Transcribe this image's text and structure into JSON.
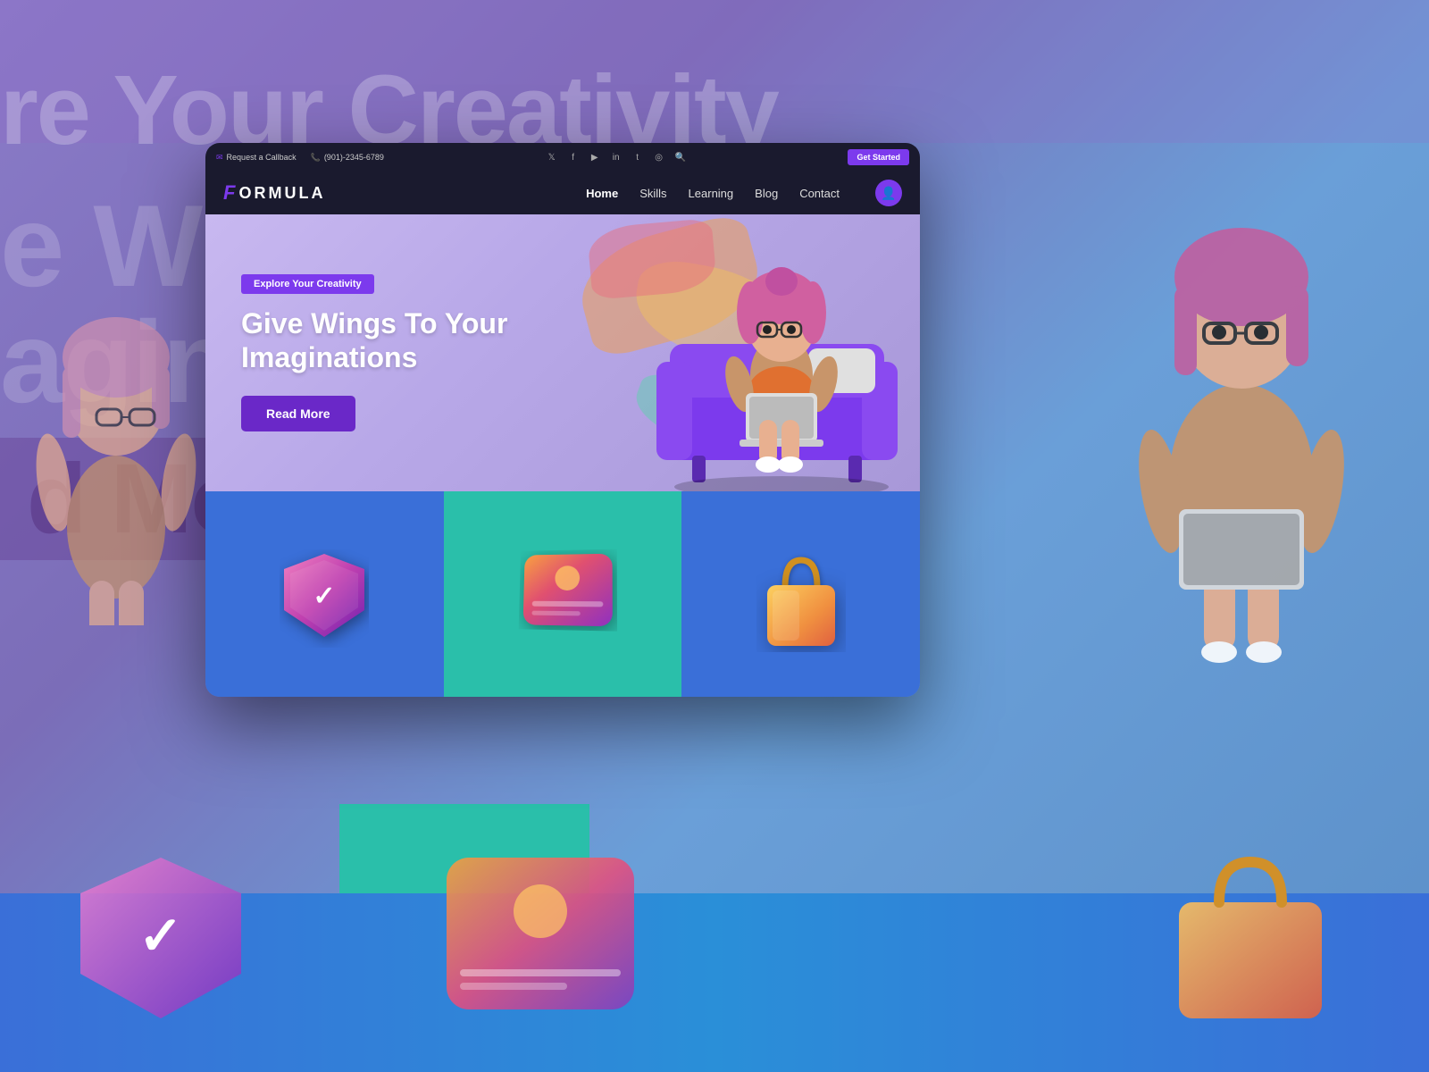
{
  "background": {
    "text_creativity": "re Your Creativity",
    "text_wings": "e Wi",
    "text_imagina": "agina",
    "text_readmore": "d More"
  },
  "topbar": {
    "callback": "Request a Callback",
    "phone": "(901)-2345-6789",
    "get_started": "Get Started",
    "social_icons": [
      "twitter",
      "facebook",
      "youtube",
      "linkedin",
      "tumblr",
      "instagram",
      "search"
    ]
  },
  "navbar": {
    "logo_f": "F",
    "logo_text": "ORMULA",
    "links": [
      {
        "label": "Home",
        "active": true
      },
      {
        "label": "Skills",
        "active": false
      },
      {
        "label": "Learning",
        "active": false
      },
      {
        "label": "Blog",
        "active": false
      },
      {
        "label": "Contact",
        "active": false
      }
    ]
  },
  "hero": {
    "tag": "Explore Your Creativity",
    "title_line1": "Give Wings To Your",
    "title_line2": "Imaginations",
    "cta": "Read More"
  },
  "cards": [
    {
      "id": "card-shield",
      "bg": "blue",
      "icon": "shield-check"
    },
    {
      "id": "card-image",
      "bg": "teal",
      "icon": "image-card"
    },
    {
      "id": "card-bag",
      "bg": "blue",
      "icon": "shopping-bag"
    }
  ]
}
